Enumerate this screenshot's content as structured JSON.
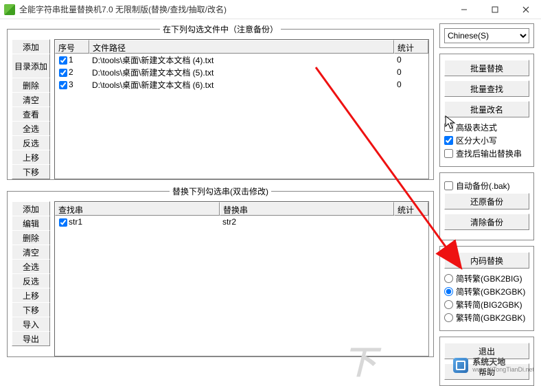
{
  "window": {
    "title": "全能字符串批量替换机7.0 无限制版(替换/查找/抽取/改名)"
  },
  "panels": {
    "files_legend": "在下列勾选文件中（注意备份）",
    "replace_legend": "替换下列勾选串(双击修改)"
  },
  "file_buttons": [
    "添加",
    "目录添加",
    "删除",
    "清空",
    "查看",
    "全选",
    "反选",
    "上移",
    "下移"
  ],
  "replace_buttons": [
    "添加",
    "编辑",
    "删除",
    "清空",
    "全选",
    "反选",
    "上移",
    "下移",
    "导入",
    "导出"
  ],
  "file_columns": {
    "seq": "序号",
    "path": "文件路径",
    "stat": "统计"
  },
  "replace_columns": {
    "find": "查找串",
    "repl": "替换串",
    "stat": "统计"
  },
  "file_rows": [
    {
      "seq": "1",
      "path": "D:\\tools\\桌面\\新建文本文档 (4).txt",
      "stat": "0",
      "checked": true
    },
    {
      "seq": "2",
      "path": "D:\\tools\\桌面\\新建文本文档 (5).txt",
      "stat": "0",
      "checked": true
    },
    {
      "seq": "3",
      "path": "D:\\tools\\桌面\\新建文本文档 (6).txt",
      "stat": "0",
      "checked": true
    }
  ],
  "replace_rows": [
    {
      "find": "str1",
      "repl": "str2",
      "stat": "",
      "checked": true
    }
  ],
  "right": {
    "language": "Chinese(S)",
    "batch_replace": "批量替换",
    "batch_find": "批量查找",
    "batch_rename": "批量改名",
    "adv_expr": "高级表达式",
    "case_sensitive": "区分大小写",
    "output_after_find": "查找后输出替换串",
    "auto_backup": "自动备份(.bak)",
    "restore_backup": "还原备份",
    "clear_backup": "清除备份",
    "encoding_replace": "内码替换",
    "enc_opts": [
      "简转繁(GBK2BIG)",
      "简转繁(GBK2GBK)",
      "繁转简(BIG2GBK)",
      "繁转简(GBK2GBK)"
    ],
    "exit": "退出",
    "help": "帮助"
  },
  "watermark": {
    "cn": "系统天地",
    "en": "www.XiTongTianDi.net"
  }
}
